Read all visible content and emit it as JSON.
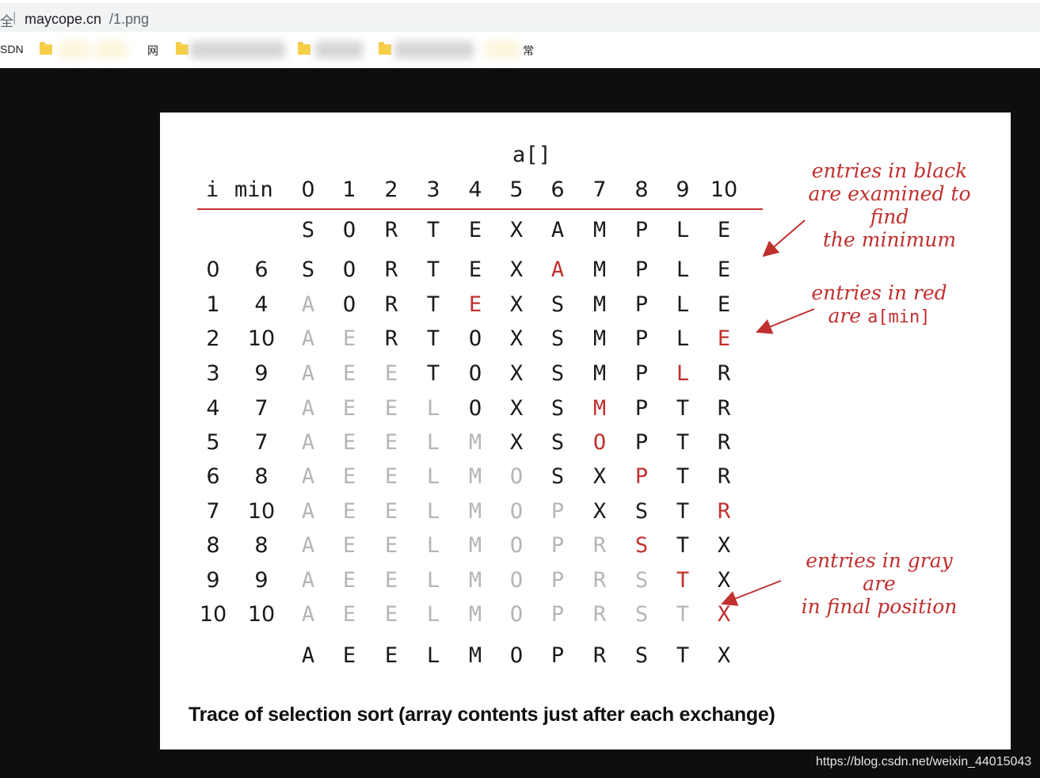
{
  "browser": {
    "security_prefix": "全",
    "url_domain": "maycope.cn",
    "url_path": "/1.png",
    "bookmarks": [
      {
        "label": "SDN"
      },
      {
        "label": "网"
      },
      {
        "label": "常"
      }
    ]
  },
  "figure": {
    "array_label": "a[]",
    "col_i_label": "i",
    "col_min_label": "min",
    "columns": [
      "0",
      "1",
      "2",
      "3",
      "4",
      "5",
      "6",
      "7",
      "8",
      "9",
      "10"
    ],
    "initial": [
      "S",
      "O",
      "R",
      "T",
      "E",
      "X",
      "A",
      "M",
      "P",
      "L",
      "E"
    ],
    "rows": [
      {
        "i": "0",
        "min": "6",
        "cells": [
          "S",
          "O",
          "R",
          "T",
          "E",
          "X",
          "A",
          "M",
          "P",
          "L",
          "E"
        ],
        "states": [
          "b",
          "b",
          "b",
          "b",
          "b",
          "b",
          "r",
          "b",
          "b",
          "b",
          "b"
        ]
      },
      {
        "i": "1",
        "min": "4",
        "cells": [
          "A",
          "O",
          "R",
          "T",
          "E",
          "X",
          "S",
          "M",
          "P",
          "L",
          "E"
        ],
        "states": [
          "g",
          "b",
          "b",
          "b",
          "r",
          "b",
          "b",
          "b",
          "b",
          "b",
          "b"
        ]
      },
      {
        "i": "2",
        "min": "10",
        "cells": [
          "A",
          "E",
          "R",
          "T",
          "O",
          "X",
          "S",
          "M",
          "P",
          "L",
          "E"
        ],
        "states": [
          "g",
          "g",
          "b",
          "b",
          "b",
          "b",
          "b",
          "b",
          "b",
          "b",
          "r"
        ]
      },
      {
        "i": "3",
        "min": "9",
        "cells": [
          "A",
          "E",
          "E",
          "T",
          "O",
          "X",
          "S",
          "M",
          "P",
          "L",
          "R"
        ],
        "states": [
          "g",
          "g",
          "g",
          "b",
          "b",
          "b",
          "b",
          "b",
          "b",
          "r",
          "b"
        ]
      },
      {
        "i": "4",
        "min": "7",
        "cells": [
          "A",
          "E",
          "E",
          "L",
          "O",
          "X",
          "S",
          "M",
          "P",
          "T",
          "R"
        ],
        "states": [
          "g",
          "g",
          "g",
          "g",
          "b",
          "b",
          "b",
          "r",
          "b",
          "b",
          "b"
        ]
      },
      {
        "i": "5",
        "min": "7",
        "cells": [
          "A",
          "E",
          "E",
          "L",
          "M",
          "X",
          "S",
          "O",
          "P",
          "T",
          "R"
        ],
        "states": [
          "g",
          "g",
          "g",
          "g",
          "g",
          "b",
          "b",
          "r",
          "b",
          "b",
          "b"
        ]
      },
      {
        "i": "6",
        "min": "8",
        "cells": [
          "A",
          "E",
          "E",
          "L",
          "M",
          "O",
          "S",
          "X",
          "P",
          "T",
          "R"
        ],
        "states": [
          "g",
          "g",
          "g",
          "g",
          "g",
          "g",
          "b",
          "b",
          "r",
          "b",
          "b"
        ]
      },
      {
        "i": "7",
        "min": "10",
        "cells": [
          "A",
          "E",
          "E",
          "L",
          "M",
          "O",
          "P",
          "X",
          "S",
          "T",
          "R"
        ],
        "states": [
          "g",
          "g",
          "g",
          "g",
          "g",
          "g",
          "g",
          "b",
          "b",
          "b",
          "r"
        ]
      },
      {
        "i": "8",
        "min": "8",
        "cells": [
          "A",
          "E",
          "E",
          "L",
          "M",
          "O",
          "P",
          "R",
          "S",
          "T",
          "X"
        ],
        "states": [
          "g",
          "g",
          "g",
          "g",
          "g",
          "g",
          "g",
          "g",
          "r",
          "b",
          "b"
        ]
      },
      {
        "i": "9",
        "min": "9",
        "cells": [
          "A",
          "E",
          "E",
          "L",
          "M",
          "O",
          "P",
          "R",
          "S",
          "T",
          "X"
        ],
        "states": [
          "g",
          "g",
          "g",
          "g",
          "g",
          "g",
          "g",
          "g",
          "g",
          "r",
          "b"
        ]
      },
      {
        "i": "10",
        "min": "10",
        "cells": [
          "A",
          "E",
          "E",
          "L",
          "M",
          "O",
          "P",
          "R",
          "S",
          "T",
          "X"
        ],
        "states": [
          "g",
          "g",
          "g",
          "g",
          "g",
          "g",
          "g",
          "g",
          "g",
          "g",
          "r"
        ]
      }
    ],
    "final": [
      "A",
      "E",
      "E",
      "L",
      "M",
      "O",
      "P",
      "R",
      "S",
      "T",
      "X"
    ],
    "annotations": {
      "black_line1": "entries in black",
      "black_line2": "are examined to find",
      "black_line3": "the minimum",
      "red_line1": "entries in red",
      "red_line2_prefix": "are ",
      "red_line2_code": "a[min]",
      "gray_line1": "entries in gray are",
      "gray_line2": "in final position"
    },
    "caption": "Trace of selection sort (array contents just after each exchange)",
    "colors": {
      "red": "#c0302f",
      "gray": "#b5b5b5",
      "black": "#1a1a1a"
    }
  },
  "watermark": "https://blog.csdn.net/weixin_44015043"
}
